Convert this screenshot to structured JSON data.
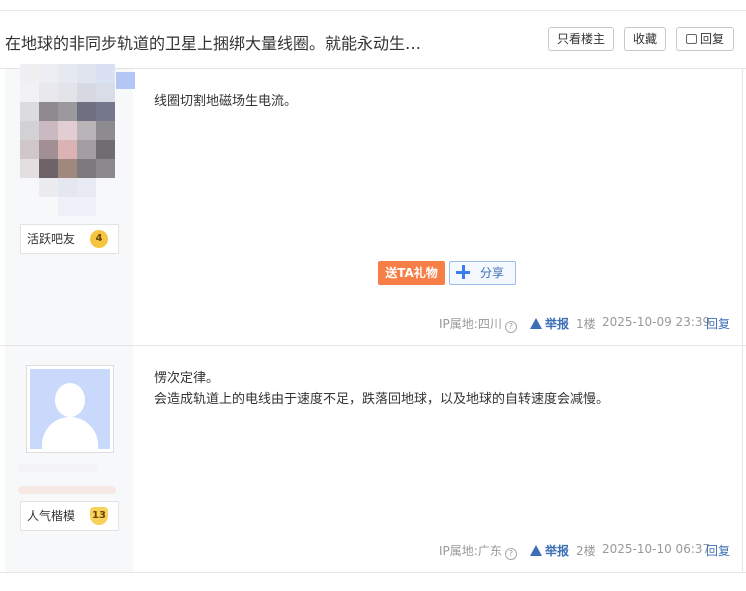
{
  "thread": {
    "title": "在地球的非同步轨道的卫星上捆绑大量线圈。就能永动生…",
    "only_op_label": "只看楼主",
    "favorite_label": "收藏",
    "reply_label": "回复"
  },
  "posts": [
    {
      "badge_label": "活跃吧友",
      "level": "4",
      "lines": [
        "线圈切割地磁场生电流。"
      ],
      "gift_label": "送TA礼物",
      "share_label": "分享",
      "ip_label": "IP属地:四川",
      "report_label": "举报",
      "floor": "1楼",
      "time": "2025-10-09 23:39",
      "reply_label": "回复"
    },
    {
      "badge_label": "人气楷模",
      "level": "13",
      "lines": [
        "愣次定律。",
        "会造成轨道上的电线由于速度不足，跌落回地球，以及地球的自转速度会减慢。"
      ],
      "ip_label": "IP属地:广东",
      "report_label": "举报",
      "floor": "2楼",
      "time": "2025-10-10 06:37",
      "reply_label": "回复"
    }
  ],
  "colors": {
    "accent_blue": "#3d6fb6",
    "gift_orange": "#f77e46",
    "level_gold": "#f5c542"
  }
}
